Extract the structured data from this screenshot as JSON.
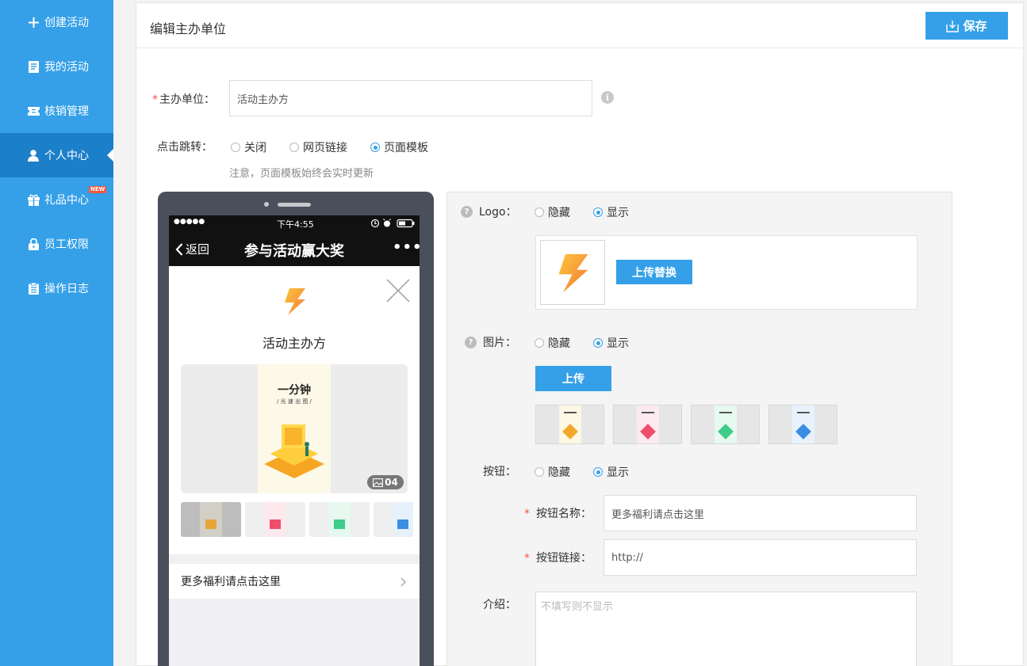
{
  "sidebar": {
    "items": [
      {
        "label": "创建活动",
        "icon": "plus-icon"
      },
      {
        "label": "我的活动",
        "icon": "document-icon"
      },
      {
        "label": "核销管理",
        "icon": "ticket-icon"
      },
      {
        "label": "个人中心",
        "icon": "user-icon",
        "active": true
      },
      {
        "label": "礼品中心",
        "icon": "gift-icon",
        "badge": "NEW"
      },
      {
        "label": "员工权限",
        "icon": "lock-icon"
      },
      {
        "label": "操作日志",
        "icon": "clipboard-icon"
      }
    ]
  },
  "header": {
    "title": "编辑主办单位",
    "save_label": "保存"
  },
  "form": {
    "organizer_label": "主办单位：",
    "organizer_value": "活动主办方",
    "click_jump_label": "点击跳转：",
    "click_jump_options": [
      "关闭",
      "网页链接",
      "页面模板"
    ],
    "click_jump_selected": "页面模板",
    "note": "注意，页面模板始终会实时更新"
  },
  "phone": {
    "status_time": "下午4:55",
    "signal": "●●●●●",
    "back_label": "返回",
    "page_title": "参与活动赢大奖",
    "more": "•••",
    "organizer_name": "活动主办方",
    "poster_title": "一分钟",
    "poster_subtitle": "/ 光 速 出 图 /",
    "image_count": "04",
    "link_text": "更多福利请点击这里"
  },
  "config": {
    "logo_label": "Logo：",
    "hide_label": "隐藏",
    "show_label": "显示",
    "upload_replace_label": "上传替换",
    "image_label": "图片：",
    "upload_label": "上传",
    "button_label": "按钮：",
    "button_name_label": "按钮名称：",
    "button_name_value": "更多福利请点击这里",
    "button_link_label": "按钮链接：",
    "button_link_value": "http://",
    "intro_label": "介绍：",
    "intro_placeholder": "不填写则不显示"
  },
  "colors": {
    "accent": "#35a0e8",
    "sidebar_active": "#1c7fc9",
    "required": "#f5573f"
  }
}
